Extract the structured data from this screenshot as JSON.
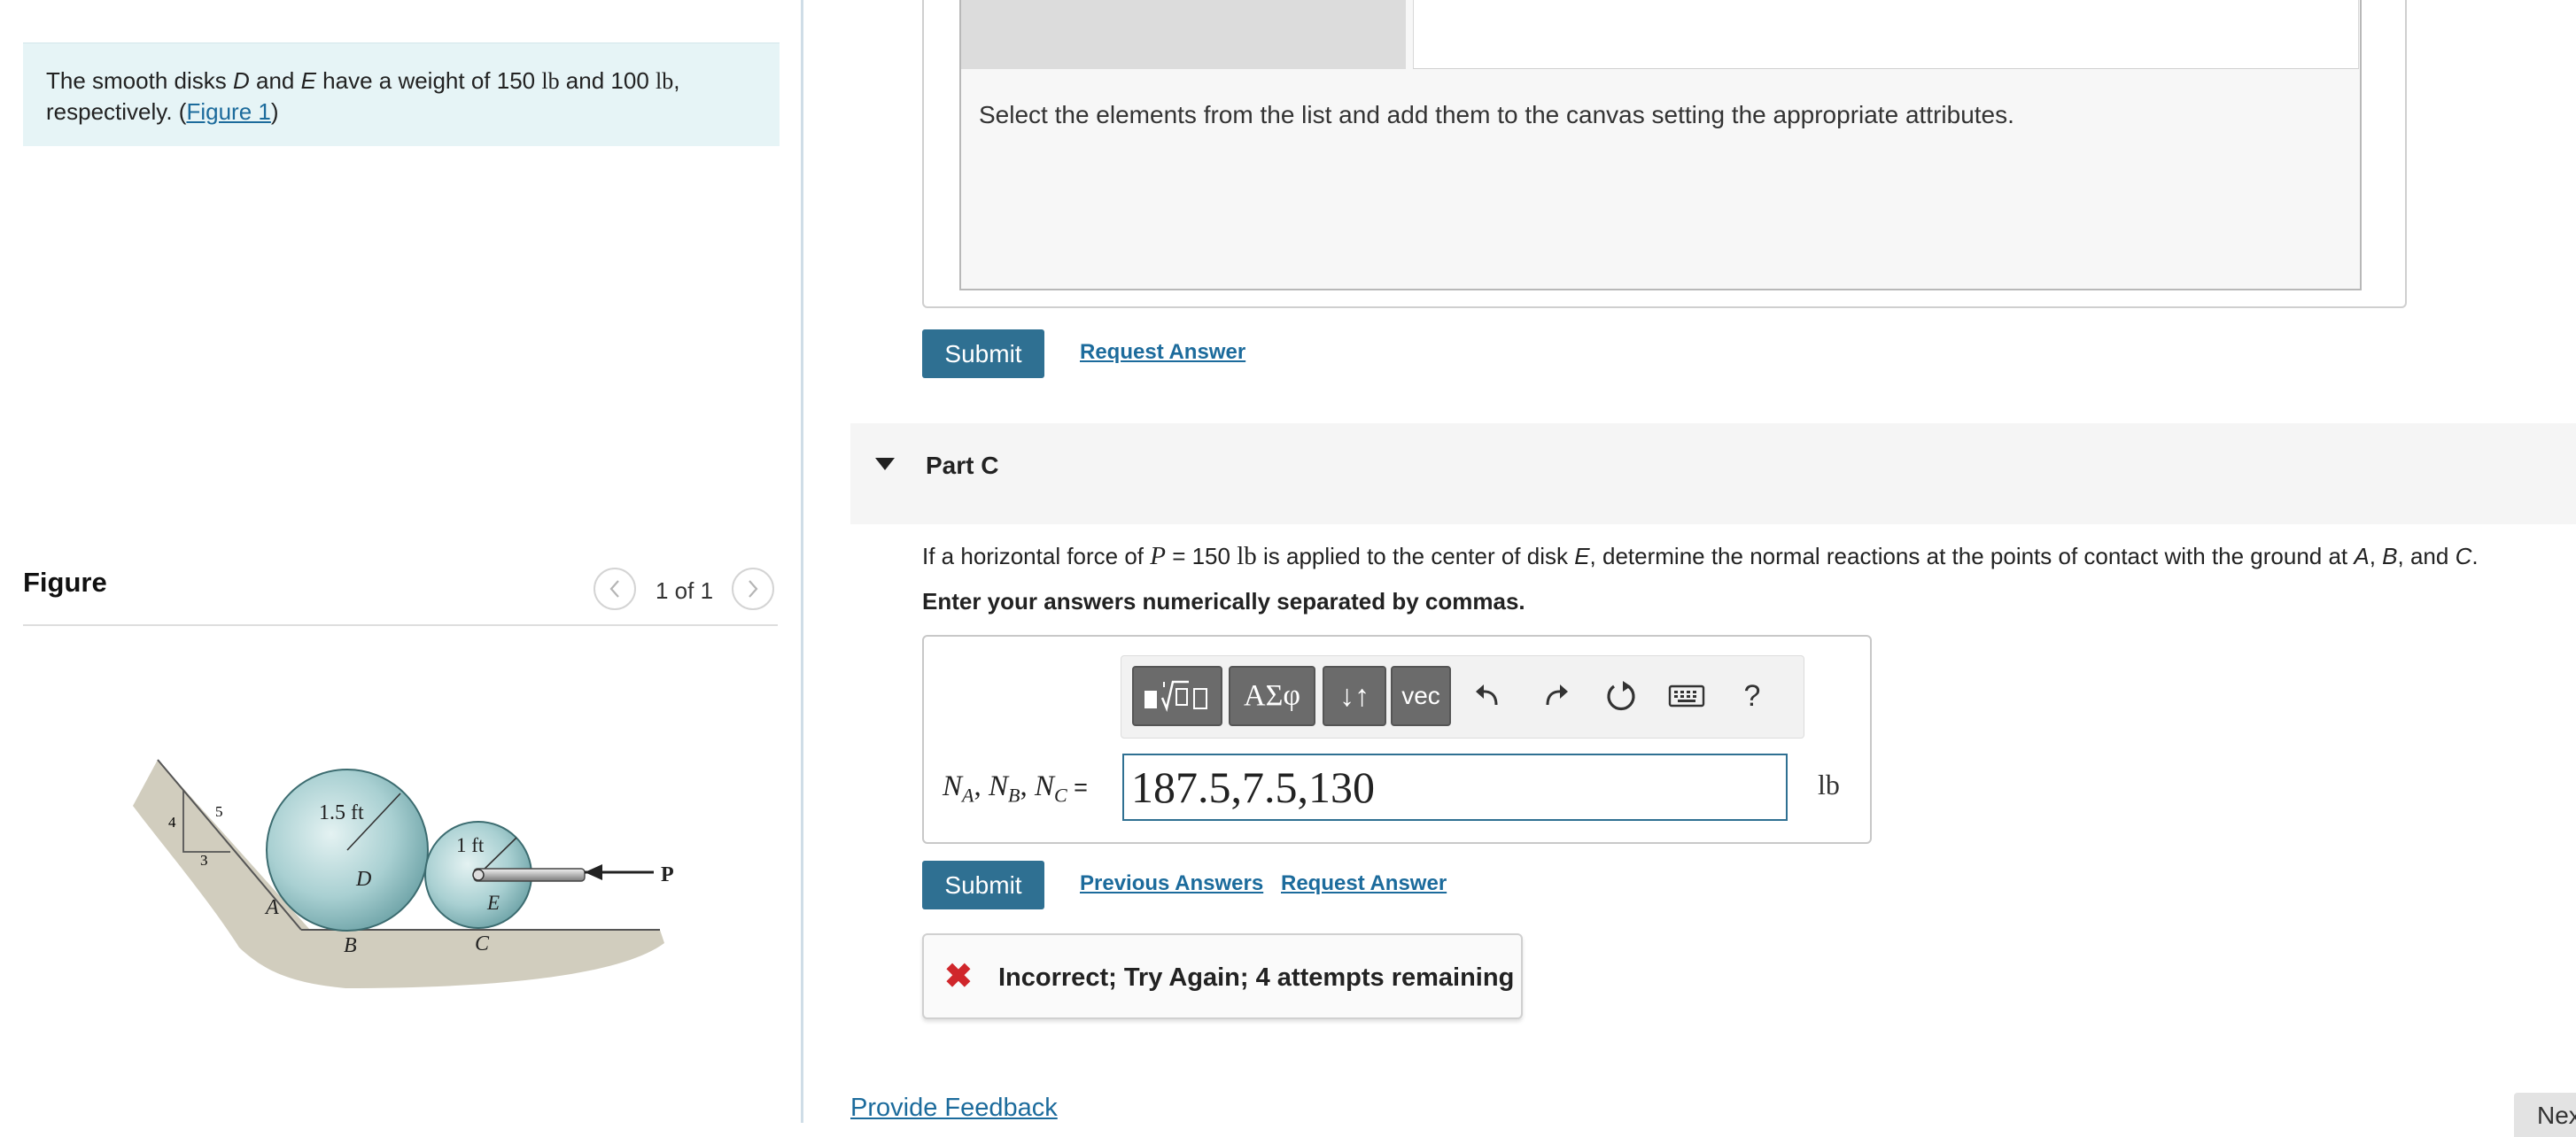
{
  "problem": {
    "text_a": "The smooth disks ",
    "disk_d": "D",
    "text_b": " and ",
    "disk_e": "E",
    "text_c": " have a weight of 150 ",
    "unit_1": "lb",
    "text_d": " and 100 ",
    "unit_2": "lb",
    "text_e": ",",
    "text_f": "respectively. (",
    "figure_link": "Figure 1",
    "text_g": ")"
  },
  "figure_panel": {
    "heading": "Figure",
    "counter": "1 of 1",
    "labels": {
      "radius_d": "1.5 ft",
      "radius_e": "1 ft",
      "disk_d": "D",
      "disk_e": "E",
      "point_a": "A",
      "point_b": "B",
      "point_c": "C",
      "force": "P",
      "slope_4": "4",
      "slope_5": "5",
      "slope_3": "3"
    }
  },
  "part_b": {
    "canvas_instruction": "Select the elements from the list and add them to the canvas setting the appropriate attributes.",
    "submit_label": "Submit",
    "request_answer_label": "Request Answer"
  },
  "part_c": {
    "title": "Part C",
    "question": {
      "q1": "If a horizontal force of ",
      "p_sym": "P",
      "q2": " = 150 ",
      "unit": "lb",
      "q3": " is applied to the center of disk ",
      "e_sym": "E",
      "q4": ", determine the normal reactions at the points of contact with the ground at ",
      "a_sym": "A",
      "q5": ", ",
      "b_sym": "B",
      "q6": ", and ",
      "c_sym": "C",
      "q7": "."
    },
    "instruction": "Enter your answers numerically separated by commas.",
    "toolbar": {
      "templates_icon": "templates-icon",
      "greek_label": "ΑΣφ",
      "arrows_label": "↓↑",
      "vec_label": "vec",
      "undo_icon": "undo-icon",
      "redo_icon": "redo-icon",
      "reset_icon": "reset-icon",
      "keyboard_icon": "keyboard-icon",
      "help_label": "?"
    },
    "answer_label": {
      "n": "N",
      "a": "A",
      "sep1": ", ",
      "b": "B",
      "sep2": ", ",
      "c": "C",
      "eq": " ="
    },
    "answer_value": "187.5,7.5,130",
    "answer_unit": "lb",
    "submit_label": "Submit",
    "previous_answers_label": "Previous Answers",
    "request_answer_label": "Request Answer",
    "feedback": "Incorrect; Try Again; 4 attempts remaining"
  },
  "footer": {
    "provide_feedback": "Provide Feedback",
    "next_label": "Next"
  },
  "colors": {
    "accent": "#2f7092",
    "link": "#1c6b9c",
    "problem_bg": "#e6f4f6",
    "error": "#d0262b",
    "disk_fill": "#9cc9cc"
  }
}
